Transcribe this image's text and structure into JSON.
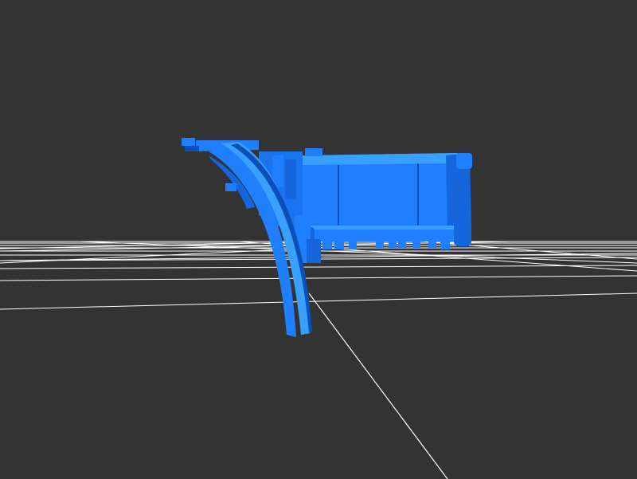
{
  "viewport": {
    "background": "#333333",
    "grid_color": "#ffffff",
    "model_color": "#1f7fff",
    "model_shadow_color": "#0b4fb8",
    "model_highlight_color": "#3aa0ff"
  },
  "scene": {
    "grid": "ground-grid",
    "axis": "depth-axis-line",
    "model": "blue-3d-mesh-model"
  }
}
